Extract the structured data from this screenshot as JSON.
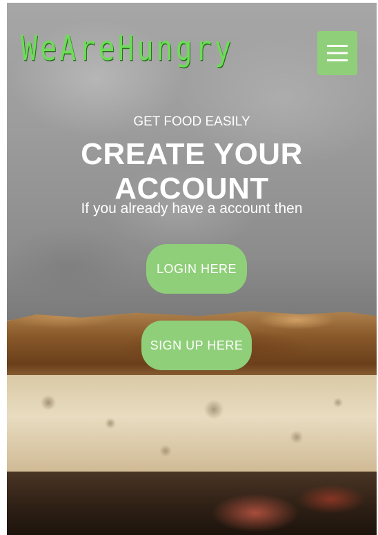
{
  "header": {
    "logo_text": "WeAreHungry",
    "menu_icon": "hamburger-menu-icon"
  },
  "hero": {
    "subtitle": "GET FOOD EASILY",
    "title": "CREATE YOUR ACCOUNT",
    "note": "If you already have a account then"
  },
  "actions": {
    "login_label": "LOGIN HERE",
    "signup_label": "SIGN UP HERE"
  },
  "colors": {
    "accent": "#8fcf79",
    "logo": "#6ddc58",
    "text": "#ffffff"
  }
}
